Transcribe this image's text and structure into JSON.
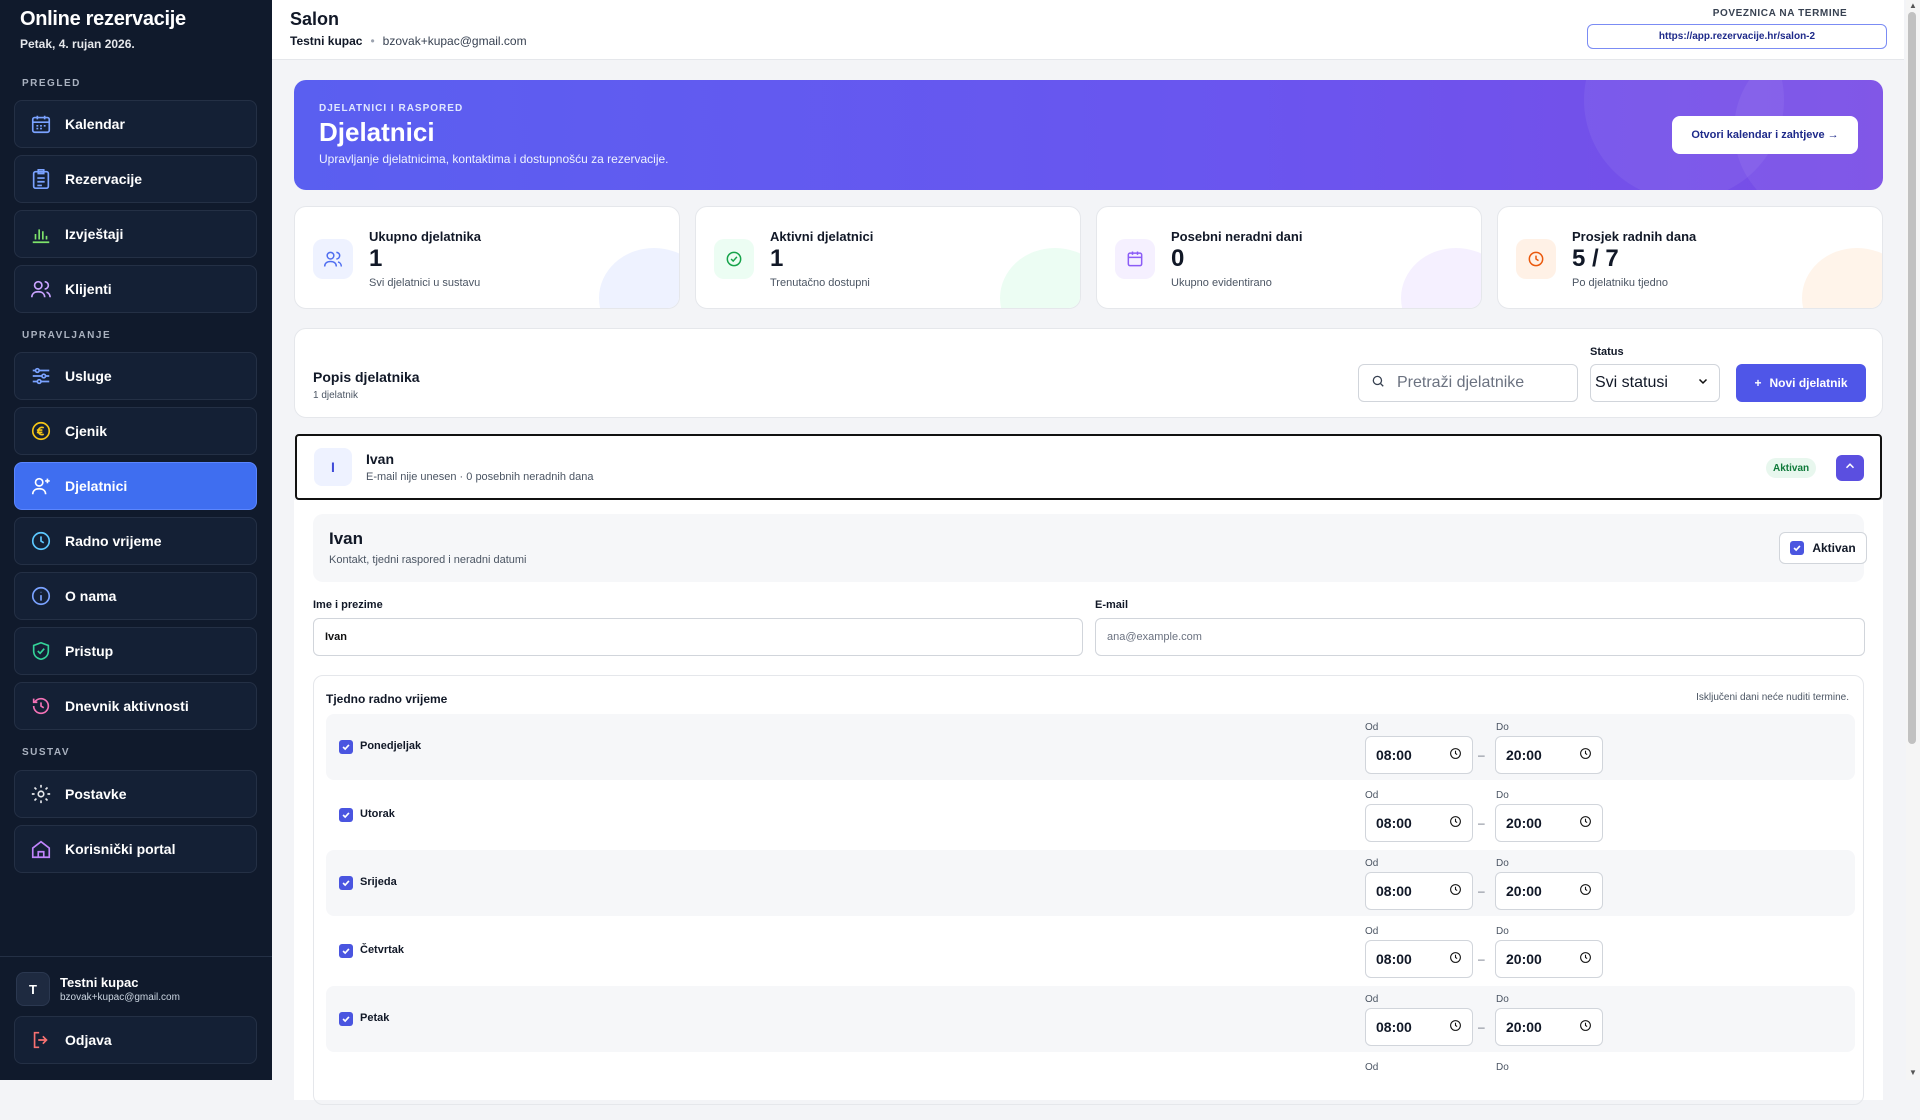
{
  "app": {
    "title": "Online rezervacije",
    "date": "Petak, 4. rujan 2026."
  },
  "sidebar": {
    "sections": [
      {
        "label": "PREGLED"
      },
      {
        "label": "UPRAVLJANJE"
      },
      {
        "label": "SUSTAV"
      }
    ],
    "items": [
      {
        "label": "Kalendar",
        "icon": "calendar-icon"
      },
      {
        "label": "Rezervacije",
        "icon": "clipboard-icon"
      },
      {
        "label": "Izvještaji",
        "icon": "bar-chart-icon"
      },
      {
        "label": "Klijenti",
        "icon": "users-icon"
      },
      {
        "label": "Usluge",
        "icon": "sliders-icon"
      },
      {
        "label": "Cjenik",
        "icon": "euro-icon"
      },
      {
        "label": "Djelatnici",
        "icon": "user-plus-icon",
        "active": true
      },
      {
        "label": "Radno vrijeme",
        "icon": "clock-icon"
      },
      {
        "label": "O nama",
        "icon": "info-icon"
      },
      {
        "label": "Pristup",
        "icon": "shield-check-icon"
      },
      {
        "label": "Dnevnik aktivnosti",
        "icon": "history-icon"
      },
      {
        "label": "Postavke",
        "icon": "gear-icon"
      },
      {
        "label": "Korisnički portal",
        "icon": "home-icon"
      }
    ],
    "user": {
      "initial": "T",
      "name": "Testni kupac",
      "email": "bzovak+kupac@gmail.com"
    },
    "logout": {
      "label": "Odjava",
      "icon": "logout-icon"
    }
  },
  "topbar": {
    "title": "Salon",
    "user": "Testni kupac",
    "email": "bzovak+kupac@gmail.com",
    "link_label": "POVEZNICA NA TERMINE",
    "link_url": "https://app.rezervacije.hr/salon-2"
  },
  "hero": {
    "kicker": "DJELATNICI I RASPORED",
    "title": "Djelatnici",
    "description": "Upravljanje djelatnicima, kontaktima i dostupnošću za rezervacije.",
    "button": "Otvori kalendar i zahtjeve →"
  },
  "stats": [
    {
      "title": "Ukupno djelatnika",
      "value": "1",
      "sub": "Svi djelatnici u sustavu",
      "icon": "users-icon",
      "color": "#4f6ef0"
    },
    {
      "title": "Aktivni djelatnici",
      "value": "1",
      "sub": "Trenutačno dostupni",
      "icon": "check-circle-icon",
      "color": "#16a34a"
    },
    {
      "title": "Posebni neradni dani",
      "value": "0",
      "sub": "Ukupno evidentirano",
      "icon": "calendar-icon",
      "color": "#8b5cf6"
    },
    {
      "title": "Prosjek radnih dana",
      "value": "5 / 7",
      "sub": "Po djelatniku tjedno",
      "icon": "clock-icon",
      "color": "#ea580c"
    }
  ],
  "list": {
    "title": "Popis djelatnika",
    "count": "1 djelatnik",
    "search_placeholder": "Pretraži djelatnike",
    "status_label": "Status",
    "status_value": "Svi statusi",
    "new_button": "Novi djelatnik"
  },
  "employee": {
    "initial": "I",
    "name": "Ivan",
    "meta": "E-mail nije unesen · 0 posebnih neradnih dana",
    "status": "Aktivan"
  },
  "detail": {
    "name": "Ivan",
    "description": "Kontakt, tjedni raspored i neradni datumi",
    "active_label": "Aktivan",
    "name_label": "Ime i prezime",
    "name_value": "Ivan",
    "email_label": "E-mail",
    "email_placeholder": "ana@example.com",
    "week_title": "Tjedno radno vrijeme",
    "week_note": "Isključeni dani neće nuditi termine.",
    "from_label": "Od",
    "to_label": "Do",
    "days": [
      {
        "name": "Ponedjeljak",
        "from": "08:00",
        "to": "20:00",
        "checked": true
      },
      {
        "name": "Utorak",
        "from": "08:00",
        "to": "20:00",
        "checked": true
      },
      {
        "name": "Srijeda",
        "from": "08:00",
        "to": "20:00",
        "checked": true
      },
      {
        "name": "Četvrtak",
        "from": "08:00",
        "to": "20:00",
        "checked": true
      },
      {
        "name": "Petak",
        "from": "08:00",
        "to": "20:00",
        "checked": true
      },
      {
        "name": "",
        "from": "",
        "to": "",
        "checked": false
      }
    ]
  },
  "colors": {
    "accent": "#4f56e8",
    "sidebar_bg": "#101a2c",
    "active_nav": "#3f6ef0"
  }
}
